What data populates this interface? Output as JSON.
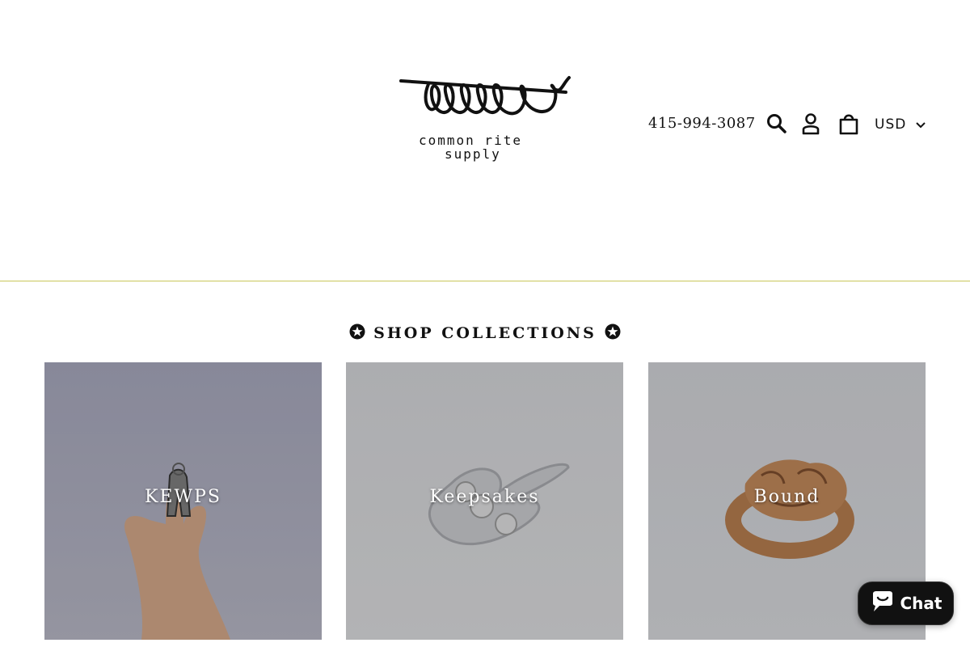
{
  "header": {
    "logo": {
      "line1": "common rite",
      "line2": "supply"
    },
    "phone": "415-994-3087",
    "icons": {
      "search": "search-icon",
      "account": "account-icon",
      "cart": "cart-icon"
    },
    "currency": {
      "selected": "USD",
      "icon": "chevron-down-icon"
    },
    "divider_color": "#c9c75a"
  },
  "collections": {
    "title": "SHOP COLLECTIONS",
    "icon": "star-circle-icon",
    "items": [
      {
        "label": "KEWPS"
      },
      {
        "label": "Keepsakes"
      },
      {
        "label": "Bound"
      }
    ]
  },
  "chat": {
    "label": "Chat",
    "icon": "chat-bubble-icon"
  }
}
